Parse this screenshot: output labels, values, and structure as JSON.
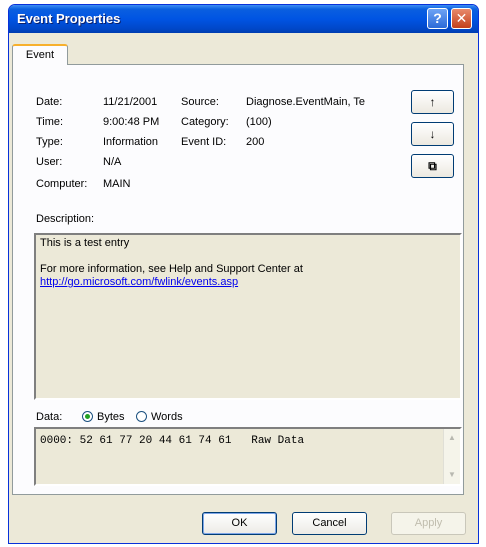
{
  "window": {
    "title": "Event Properties",
    "help_glyph": "?",
    "close_glyph": "✕"
  },
  "tab": {
    "label": "Event"
  },
  "fields": {
    "date_label": "Date:",
    "date_value": "11/21/2001",
    "time_label": "Time:",
    "time_value": "9:00:48 PM",
    "type_label": "Type:",
    "type_value": "Information",
    "user_label": "User:",
    "user_value": "N/A",
    "computer_label": "Computer:",
    "computer_value": "MAIN",
    "source_label": "Source:",
    "source_value": "Diagnose.EventMain, Te",
    "category_label": "Category:",
    "category_value": "(100)",
    "event_id_label": "Event ID:",
    "event_id_value": "200"
  },
  "nav": {
    "up_glyph": "↑",
    "down_glyph": "↓",
    "copy_glyph": "⧉"
  },
  "description": {
    "label": "Description:",
    "line1": "This is a test entry",
    "line2": "For more information, see Help and Support Center at",
    "link": "http://go.microsoft.com/fwlink/events.asp"
  },
  "data": {
    "label": "Data:",
    "bytes_label": "Bytes",
    "words_label": "Words",
    "selected": "Bytes",
    "hex_line": "0000: 52 61 77 20 44 61 74 61   Raw Data"
  },
  "buttons": {
    "ok": "OK",
    "cancel": "Cancel",
    "apply": "Apply"
  },
  "colors": {
    "titlebar": "#0054e3",
    "window_bg": "#ece9d8",
    "link": "#0000ee",
    "tab_accent": "#f7b02c"
  }
}
